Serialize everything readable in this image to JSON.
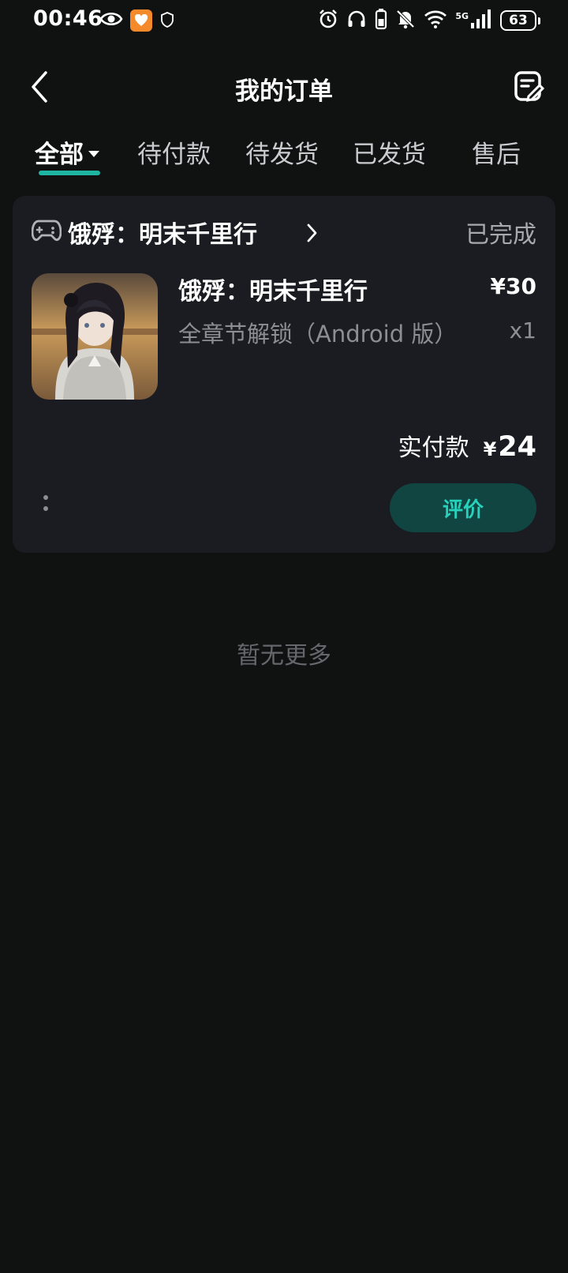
{
  "status_bar": {
    "time": "00:46",
    "network": "5G",
    "battery": "63",
    "icons": [
      "eye-icon",
      "app-heart-icon",
      "app-shield-icon",
      "alarm-icon",
      "headphones-icon",
      "battery-small-icon",
      "mute-icon",
      "wifi-icon",
      "signal-icon"
    ]
  },
  "header": {
    "title": "我的订单",
    "back_icon": "back-arrow-icon",
    "action_icon": "edit-note-icon"
  },
  "tabs": [
    {
      "label": "全部",
      "active": true
    },
    {
      "label": "待付款",
      "active": false
    },
    {
      "label": "待发货",
      "active": false
    },
    {
      "label": "已发货",
      "active": false
    },
    {
      "label": "售后",
      "active": false
    }
  ],
  "order": {
    "store_icon": "gamepad-icon",
    "store_name": "饿殍：明末千里行",
    "status": "已完成",
    "item": {
      "name": "饿殍：明末千里行",
      "price": "¥30",
      "spec": "全章节解锁（Android 版）",
      "quantity": "x1"
    },
    "paid_label": "实付款",
    "paid_currency": "¥",
    "paid_amount": "24",
    "review_button": "评价"
  },
  "footer_text": "暂无更多",
  "colors": {
    "background": "#101212",
    "card": "#1b1c22",
    "accent": "#1fb5a3",
    "button_bg": "#114542",
    "button_text": "#27d1bc"
  }
}
